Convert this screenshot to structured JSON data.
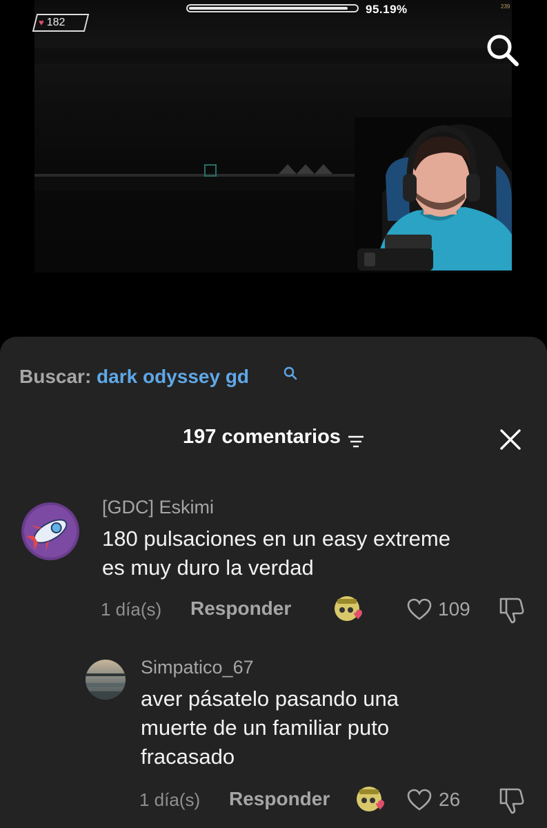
{
  "video": {
    "hp_value": "182",
    "progress_percent": "95.19%",
    "progress_fraction": 0.9519,
    "fps_readout": "239",
    "search_icon": "search-icon"
  },
  "sheet": {
    "search_label": "Buscar:",
    "search_term": "dark odyssey gd",
    "comment_count": "197 comentarios",
    "sort_icon": "sort-icon",
    "close_icon": "close-icon"
  },
  "comments": [
    {
      "username": "[GDC] Eskimi",
      "text_lines": [
        "180 pulsaciones en un easy extreme",
        "es muy duro la verdad"
      ],
      "date": "1 día(s)",
      "reply_label": "Responder",
      "likes": "109",
      "creator_badge": "creator-liked-badge",
      "avatar_icon": "rocket-icon"
    },
    {
      "username": "Simpatico_67",
      "text_lines": [
        "aver pásatelo pasando una",
        "muerte de un familiar puto",
        "fracasado"
      ],
      "date": "1 día(s)",
      "reply_label": "Responder",
      "likes": "26",
      "creator_badge": "creator-liked-badge",
      "avatar_icon": "beach-photo"
    }
  ],
  "colors": {
    "accent_link": "#5fa8e8",
    "sheet_bg": "#232323",
    "muted_text": "#a6a6a6",
    "heart": "#e0506a"
  }
}
